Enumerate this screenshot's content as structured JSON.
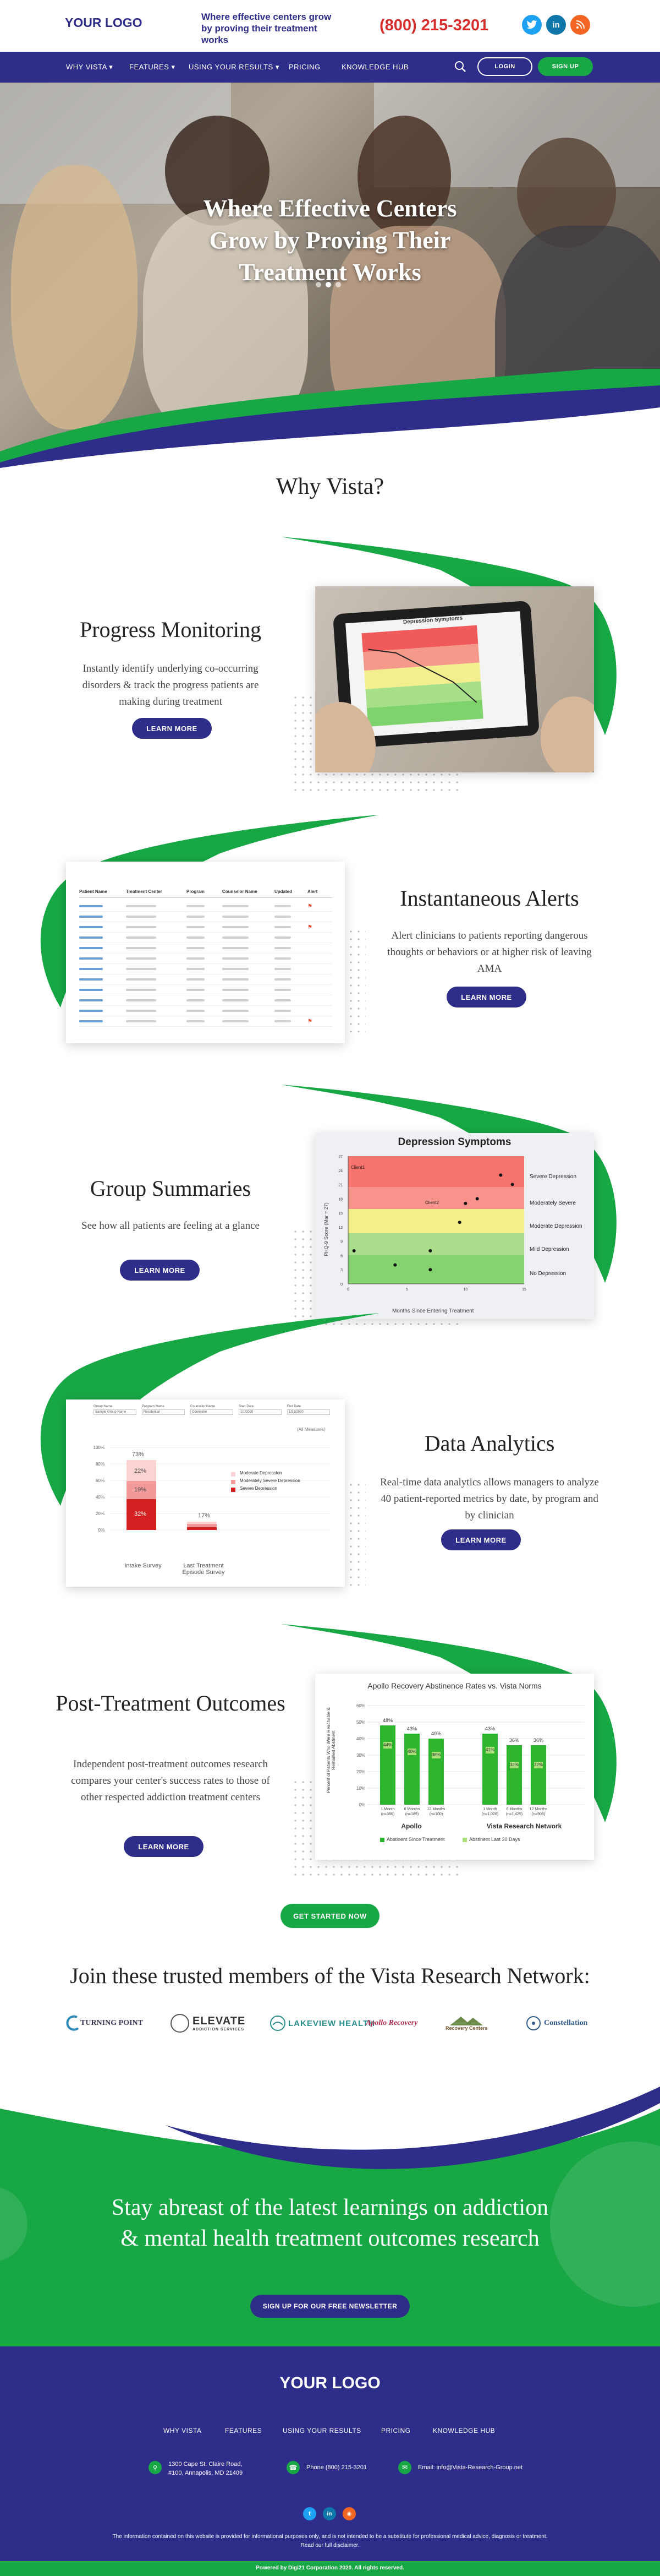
{
  "header": {
    "logo": "YOUR LOGO",
    "tagline": "Where effective centers grow by proving their treatment works",
    "phone": "(800) 215-3201",
    "social": [
      {
        "icon": "twitter-icon",
        "glyph": "t",
        "color": "#1da1f2"
      },
      {
        "icon": "linkedin-icon",
        "glyph": "in",
        "color": "#0e76a8"
      },
      {
        "icon": "rss-icon",
        "glyph": "◉",
        "color": "#f26522"
      }
    ]
  },
  "nav": {
    "items": [
      "WHY VISTA",
      "FEATURES",
      "USING YOUR RESULTS",
      "PRICING",
      "KNOWLEDGE HUB"
    ],
    "login": "LOGIN",
    "signup": "SIGN UP"
  },
  "hero": {
    "title": "Where Effective Centers Grow by Proving Their Treatment Works"
  },
  "why": {
    "title": "Why Vista?"
  },
  "features": [
    {
      "title": "Progress Monitoring",
      "text": "Instantly identify underlying co-occurring disorders & track the progress patients are making during treatment",
      "button": "LEARN MORE"
    },
    {
      "title": "Instantaneous Alerts",
      "text": "Alert clinicians to patients reporting dangerous thoughts or behaviors or at higher risk of leaving AMA",
      "button": "LEARN MORE"
    },
    {
      "title": "Group Summaries",
      "text": "See how all patients are feeling at a glance",
      "button": "LEARN MORE"
    },
    {
      "title": "Data Analytics",
      "text": "Real-time data analytics allows managers to analyze 40 patient-reported metrics by date, by program and by clinician",
      "button": "LEARN MORE"
    },
    {
      "title": "Post-Treatment Outcomes",
      "text": "Independent post-treatment outcomes research compares your center's success rates to those of other respected addiction treatment centers",
      "button": "LEARN MORE"
    }
  ],
  "tablet": {
    "title": "Depression Symptoms"
  },
  "alerts_table": {
    "headers": [
      "Patient Name",
      "Treatment Center",
      "Program",
      "Counselor Name",
      "Updated",
      "Alert"
    ]
  },
  "group_chart": {
    "title": "Depression Symptoms",
    "xlabel": "Months Since Entering Treatment",
    "ylabel": "PHQ-9 Score (Mar = 27)",
    "bands": [
      "Severe Depression",
      "Moderately Severe",
      "Moderate Depression",
      "Mild Depression",
      "No Depression"
    ],
    "point_labels": [
      "Client1",
      "Client2"
    ],
    "y_ticks": [
      "0",
      "3",
      "6",
      "9",
      "12",
      "15",
      "18",
      "21",
      "24",
      "27"
    ],
    "x_ticks": [
      "0",
      "5",
      "10",
      "15"
    ]
  },
  "analytics_chart": {
    "filter_labels": [
      "Group Name",
      "Program Name",
      "Counselor Name",
      "Start Date",
      "End Date"
    ],
    "filter_values": [
      "Sample Group Name",
      "Residential",
      "Counselor",
      "1/1/2020",
      "1/31/2020"
    ],
    "summary": "(All Measures)",
    "y_ticks": [
      "100%",
      "80%",
      "60%",
      "40%",
      "20%",
      "0%"
    ],
    "bar1_labels": [
      "73%",
      "22%",
      "19%",
      "32%"
    ],
    "bar2_labels": [
      "17%"
    ],
    "x_labels": [
      "Intake Survey",
      "Last Treatment Episode Survey"
    ],
    "legend": [
      "Moderate Depression",
      "Moderately Severe Depression",
      "Severe Depression"
    ]
  },
  "outcomes_chart": {
    "title": "Apollo Recovery Abstinence Rates vs. Vista Norms",
    "ylabel": "Percent of Patients Who Were Reachable & Remained Abstinent",
    "groups": [
      "Apollo",
      "Vista Research Network"
    ],
    "x_labels": [
      "1 Month (n=386)",
      "6 Months (n=189)",
      "12 Months (n=100)",
      "1 Month (n=1,026)",
      "6 Months (n=1,425)",
      "12 Months (n=908)"
    ],
    "top_labels": [
      "48%",
      "43%",
      "40%",
      "43%",
      "36%",
      "36%"
    ],
    "inner_labels": [
      "44%",
      "40%",
      "38%",
      "41%",
      "32%",
      "32%"
    ],
    "y_ticks": [
      "60%",
      "50%",
      "40%",
      "30%",
      "20%",
      "10%",
      "0%"
    ],
    "legend": [
      "Abstinent Since Treatment",
      "Abstinent Last 30 Days"
    ]
  },
  "cta": {
    "button": "GET STARTED NOW"
  },
  "partners": {
    "title": "Join these trusted members of the Vista Research Network:",
    "logos": [
      "TURNING POINT",
      "ELEVATE",
      "LAKEVIEW HEALTH",
      "Apollo Recovery",
      "Recovery Centers",
      "Constellation"
    ],
    "sublabels": [
      "",
      "ADDICTION SERVICES",
      "",
      "",
      "",
      ""
    ]
  },
  "newsletter": {
    "title": "Stay abreast of the latest learnings on addiction & mental health treatment outcomes research",
    "button": "SIGN UP FOR OUR FREE NEWSLETTER"
  },
  "footer": {
    "logo": "YOUR LOGO",
    "nav": [
      "WHY VISTA",
      "FEATURES",
      "USING YOUR RESULTS",
      "PRICING",
      "KNOWLEDGE HUB"
    ],
    "address": "1300 Cape St. Claire Road, #100, Annapolis, MD 21409",
    "phone": "Phone (800) 215-3201",
    "email": "Email: info@Vista-Research-Group.net",
    "disclaimer": "The information contained on this website is provided for informational purposes only, and is not intended to be a substitute for professional medical advice, diagnosis or treatment. Read our full disclaimer.",
    "copyright": "Powered by Digi21 Corporation 2020. All rights reserved."
  },
  "colors": {
    "navy": "#2e2e8a",
    "green": "#17a745",
    "red": "#d62d2d"
  }
}
